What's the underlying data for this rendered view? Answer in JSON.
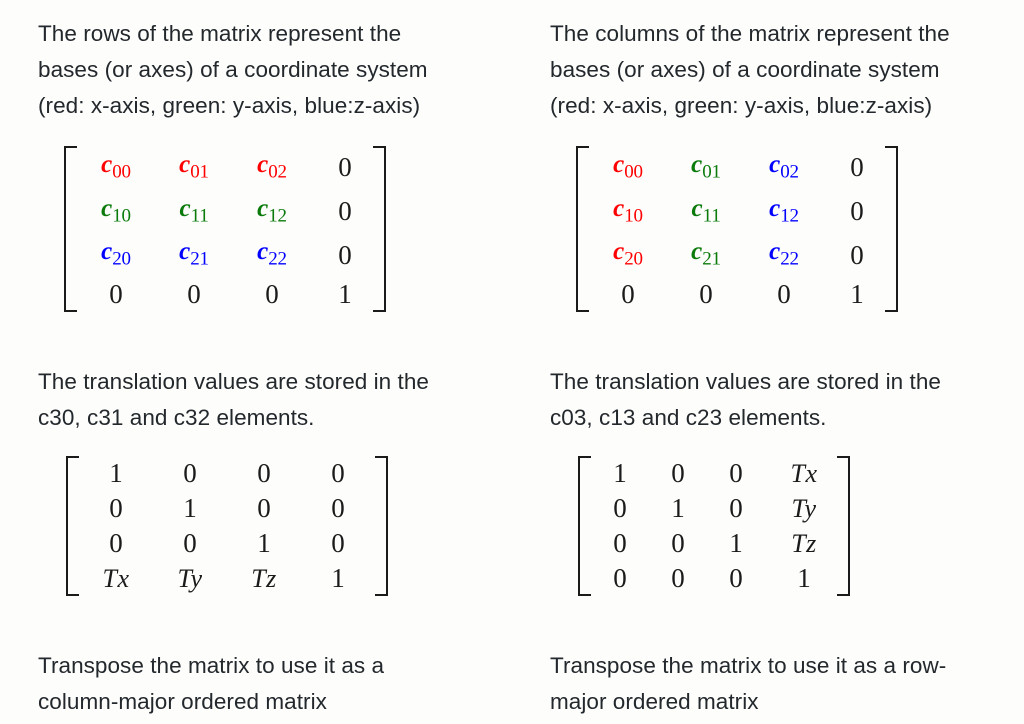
{
  "colors": {
    "background": "#fdfdfc",
    "text": "#23282c",
    "matrix_ink": "#1b1b1b",
    "x_axis_red": "#ff0000",
    "y_axis_green": "#0a7a0a",
    "z_axis_blue": "#0000ff"
  },
  "left": {
    "intro": {
      "line1": "The rows of the matrix represent the",
      "line2": "bases (or axes) of a coordinate system",
      "line3": "(red: x-axis, green: y-axis, blue:z-axis)"
    },
    "basis_matrix": {
      "rows": [
        [
          {
            "base": "c",
            "sub": "00",
            "color": "x"
          },
          {
            "base": "c",
            "sub": "01",
            "color": "x"
          },
          {
            "base": "c",
            "sub": "02",
            "color": "x"
          },
          {
            "num": "0",
            "color": "n"
          }
        ],
        [
          {
            "base": "c",
            "sub": "10",
            "color": "y"
          },
          {
            "base": "c",
            "sub": "11",
            "color": "y"
          },
          {
            "base": "c",
            "sub": "12",
            "color": "y"
          },
          {
            "num": "0",
            "color": "n"
          }
        ],
        [
          {
            "base": "c",
            "sub": "20",
            "color": "z"
          },
          {
            "base": "c",
            "sub": "21",
            "color": "z"
          },
          {
            "base": "c",
            "sub": "22",
            "color": "z"
          },
          {
            "num": "0",
            "color": "n"
          }
        ],
        [
          {
            "num": "0",
            "color": "n"
          },
          {
            "num": "0",
            "color": "n"
          },
          {
            "num": "0",
            "color": "n"
          },
          {
            "num": "1",
            "color": "n"
          }
        ]
      ]
    },
    "translation_note": {
      "line1": "The translation values are stored in the",
      "line2": "c30, c31 and c32 elements."
    },
    "translation_matrix": {
      "rows": [
        [
          {
            "num": "1"
          },
          {
            "num": "0"
          },
          {
            "num": "0"
          },
          {
            "num": "0"
          }
        ],
        [
          {
            "num": "0"
          },
          {
            "num": "1"
          },
          {
            "num": "0"
          },
          {
            "num": "0"
          }
        ],
        [
          {
            "num": "0"
          },
          {
            "num": "0"
          },
          {
            "num": "1"
          },
          {
            "num": "0"
          }
        ],
        [
          {
            "var": "Tx"
          },
          {
            "var": "Ty"
          },
          {
            "var": "Tz"
          },
          {
            "num": "1"
          }
        ]
      ]
    },
    "conclusion": {
      "line1": "Transpose the matrix to use it as a",
      "line2": "column-major ordered matrix"
    }
  },
  "right": {
    "intro": {
      "line1": "The columns of the matrix represent the",
      "line2": "bases (or axes) of a coordinate system",
      "line3": "(red: x-axis, green: y-axis, blue:z-axis)"
    },
    "basis_matrix": {
      "rows": [
        [
          {
            "base": "c",
            "sub": "00",
            "color": "x"
          },
          {
            "base": "c",
            "sub": "01",
            "color": "y"
          },
          {
            "base": "c",
            "sub": "02",
            "color": "z"
          },
          {
            "num": "0",
            "color": "n"
          }
        ],
        [
          {
            "base": "c",
            "sub": "10",
            "color": "x"
          },
          {
            "base": "c",
            "sub": "11",
            "color": "y"
          },
          {
            "base": "c",
            "sub": "12",
            "color": "z"
          },
          {
            "num": "0",
            "color": "n"
          }
        ],
        [
          {
            "base": "c",
            "sub": "20",
            "color": "x"
          },
          {
            "base": "c",
            "sub": "21",
            "color": "y"
          },
          {
            "base": "c",
            "sub": "22",
            "color": "z"
          },
          {
            "num": "0",
            "color": "n"
          }
        ],
        [
          {
            "num": "0",
            "color": "n"
          },
          {
            "num": "0",
            "color": "n"
          },
          {
            "num": "0",
            "color": "n"
          },
          {
            "num": "1",
            "color": "n"
          }
        ]
      ]
    },
    "translation_note": {
      "line1": "The translation values are stored in the",
      "line2": "c03, c13 and c23 elements."
    },
    "translation_matrix": {
      "rows": [
        [
          {
            "num": "1"
          },
          {
            "num": "0"
          },
          {
            "num": "0"
          },
          {
            "var": "Tx"
          }
        ],
        [
          {
            "num": "0"
          },
          {
            "num": "1"
          },
          {
            "num": "0"
          },
          {
            "var": "Ty"
          }
        ],
        [
          {
            "num": "0"
          },
          {
            "num": "0"
          },
          {
            "num": "1"
          },
          {
            "var": "Tz"
          }
        ],
        [
          {
            "num": "0"
          },
          {
            "num": "0"
          },
          {
            "num": "0"
          },
          {
            "num": "1"
          }
        ]
      ]
    },
    "conclusion": {
      "line1": "Transpose the matrix to use it as a row-",
      "line2": "major ordered matrix"
    }
  }
}
